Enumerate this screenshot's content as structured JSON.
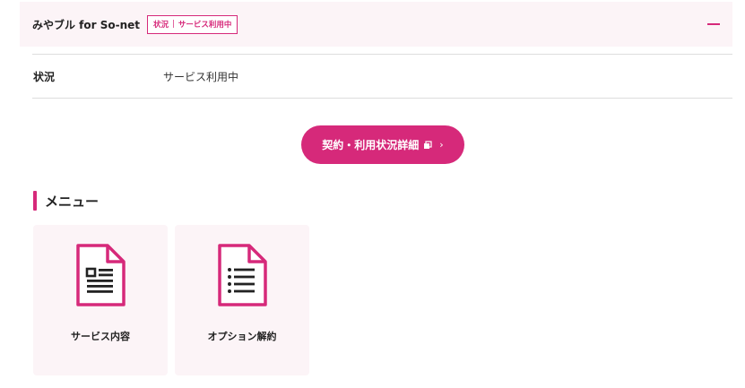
{
  "header": {
    "title": "みやブル for So-net",
    "badge_prefix": "状況",
    "badge_value": "サービス利用中"
  },
  "status_row": {
    "label": "状況",
    "value": "サービス利用中"
  },
  "detail_button": {
    "label": "契約・利用状況詳細"
  },
  "menu": {
    "heading": "メニュー",
    "items": [
      {
        "label": "サービス内容",
        "icon": "document-form-icon"
      },
      {
        "label": "オプション解約",
        "icon": "document-list-icon"
      }
    ]
  },
  "colors": {
    "accent": "#d6297a",
    "card_background": "#fcf4f7"
  }
}
